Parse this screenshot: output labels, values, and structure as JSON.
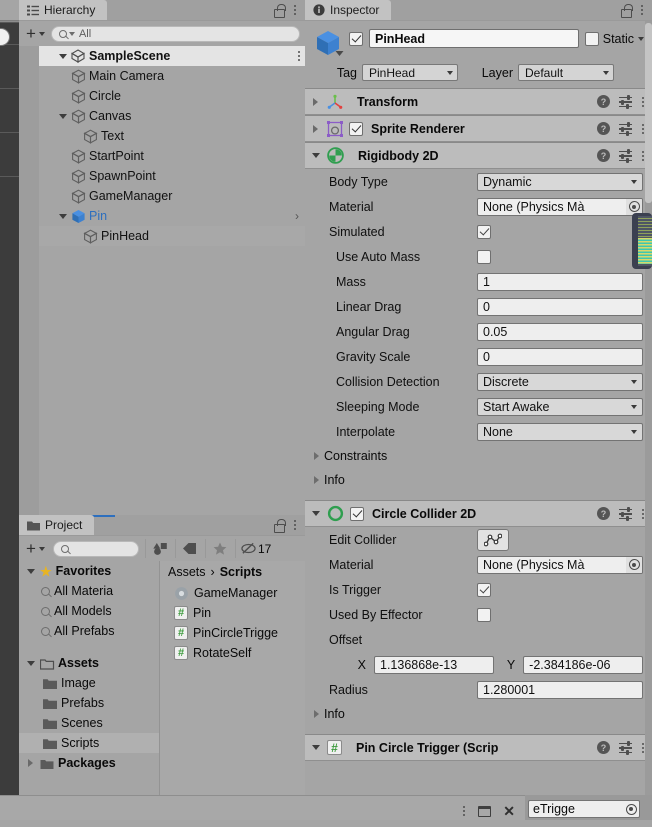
{
  "hierarchy": {
    "tab_label": "Hierarchy",
    "tab_icon": "hierarchy-icon",
    "lock_icon": "lock-icon",
    "menu_icon": "kebab-menu-icon",
    "add_label": "+",
    "search_placeholder": "All",
    "search_value": "",
    "scene": {
      "name": "SampleScene",
      "expanded": true
    },
    "items": [
      {
        "name": "Main Camera",
        "depth": 2,
        "expandable": false,
        "selected": false,
        "prefab": false
      },
      {
        "name": "Circle",
        "depth": 2,
        "expandable": false,
        "selected": false,
        "prefab": false
      },
      {
        "name": "Canvas",
        "depth": 2,
        "expandable": true,
        "selected": false,
        "prefab": false
      },
      {
        "name": "Text",
        "depth": 3,
        "expandable": false,
        "selected": false,
        "prefab": false
      },
      {
        "name": "StartPoint",
        "depth": 2,
        "expandable": false,
        "selected": false,
        "prefab": false
      },
      {
        "name": "SpawnPoint",
        "depth": 2,
        "expandable": false,
        "selected": false,
        "prefab": false
      },
      {
        "name": "GameManager",
        "depth": 2,
        "expandable": false,
        "selected": false,
        "prefab": false
      },
      {
        "name": "Pin",
        "depth": 2,
        "expandable": true,
        "selected": false,
        "prefab": true
      },
      {
        "name": "PinHead",
        "depth": 3,
        "expandable": false,
        "selected": true,
        "prefab": false
      }
    ]
  },
  "project": {
    "tab_label": "Project",
    "tab_icon": "folder-icon",
    "add_label": "+",
    "search_placeholder": "",
    "search_value": "",
    "toolbar_icons": [
      "packages-icon",
      "label-icon",
      "favorite-star-icon",
      "hidden-count-icon"
    ],
    "hidden_count": "17",
    "favorites": {
      "label": "Favorites",
      "items": [
        "All Materia",
        "All Models",
        "All Prefabs"
      ]
    },
    "assets": {
      "label": "Assets",
      "items": [
        "Image",
        "Prefabs",
        "Scenes",
        "Scripts"
      ],
      "selected": "Scripts"
    },
    "packages": {
      "label": "Packages"
    },
    "breadcrumb": {
      "root": "Assets",
      "separator": "›",
      "current": "Scripts"
    },
    "files": [
      {
        "name": "GameManager",
        "icon": "gear-script-icon"
      },
      {
        "name": "Pin",
        "icon": "csharp-script-icon"
      },
      {
        "name": "PinCircleTrigge",
        "icon": "csharp-script-icon"
      },
      {
        "name": "RotateSelf",
        "icon": "csharp-script-icon"
      }
    ]
  },
  "inspector": {
    "tab_label": "Inspector",
    "tab_icon": "info-icon",
    "lock_icon": "lock-icon",
    "menu_icon": "kebab-menu-icon",
    "object": {
      "icon": "prefab-cube-icon",
      "enabled": true,
      "name": "PinHead",
      "static_label": "Static",
      "static_checked": false,
      "tag_label": "Tag",
      "tag_value": "PinHead",
      "layer_label": "Layer",
      "layer_value": "Default"
    },
    "components": [
      {
        "id": "transform",
        "title": "Transform",
        "icon": "transform-axis-icon",
        "expanded": false,
        "has_toggle": false
      },
      {
        "id": "sprite-renderer",
        "title": "Sprite Renderer",
        "icon": "sprite-renderer-icon",
        "expanded": false,
        "has_toggle": true,
        "enabled": true
      },
      {
        "id": "rigidbody-2d",
        "title": "Rigidbody 2D",
        "icon": "rigidbody2d-icon",
        "expanded": true,
        "has_toggle": false,
        "properties": [
          {
            "label": "Body Type",
            "type": "dropdown",
            "value": "Dynamic"
          },
          {
            "label": "Material",
            "type": "object",
            "value": "None (Physics Mà"
          },
          {
            "label": "Simulated",
            "type": "checkbox",
            "value": true
          },
          {
            "label": "Use Auto Mass",
            "type": "checkbox",
            "value": false,
            "indent": true
          },
          {
            "label": "Mass",
            "type": "text",
            "value": "1",
            "indent": true
          },
          {
            "label": "Linear Drag",
            "type": "text",
            "value": "0",
            "indent": true
          },
          {
            "label": "Angular Drag",
            "type": "text",
            "value": "0.05",
            "indent": true
          },
          {
            "label": "Gravity Scale",
            "type": "text",
            "value": "0",
            "indent": true
          },
          {
            "label": "Collision Detection",
            "type": "dropdown",
            "value": "Discrete",
            "indent": true
          },
          {
            "label": "Sleeping Mode",
            "type": "dropdown",
            "value": "Start Awake",
            "indent": true
          },
          {
            "label": "Interpolate",
            "type": "dropdown",
            "value": "None",
            "indent": true
          }
        ],
        "foldouts": [
          "Constraints",
          "Info"
        ]
      },
      {
        "id": "circle-collider-2d",
        "title": "Circle Collider 2D",
        "icon": "circle-collider2d-icon",
        "expanded": true,
        "has_toggle": true,
        "enabled": true,
        "properties": [
          {
            "label": "Edit Collider",
            "type": "button",
            "value": "edit-collider-icon"
          },
          {
            "label": "Material",
            "type": "object",
            "value": "None (Physics Mà"
          },
          {
            "label": "Is Trigger",
            "type": "checkbox",
            "value": true
          },
          {
            "label": "Used By Effector",
            "type": "checkbox",
            "value": false
          },
          {
            "label": "Offset",
            "type": "header"
          },
          {
            "label": "Radius",
            "type": "text",
            "value": "1.280001"
          }
        ],
        "offset": {
          "x_label": "X",
          "x_value": "1.136868e-13",
          "y_label": "Y",
          "y_value": "-2.384186e-06"
        },
        "foldouts": [
          "Info"
        ]
      },
      {
        "id": "pin-circle-trigger-script",
        "title": "Pin Circle Trigger (Scrip",
        "icon": "csharp-script-icon",
        "expanded": true,
        "has_toggle": false
      }
    ]
  },
  "floating_bar": {
    "menu_icon": "kebab-menu-icon",
    "maximize_icon": "window-icon",
    "close_icon": "close-icon",
    "trailing_field_value": "eTrigge"
  },
  "colors": {
    "panel_bg": "#a5a5a5",
    "tab_active": "#c2c2c2",
    "tab_bar": "#a0a0a0",
    "component_header": "#bcbcbc",
    "field_bg": "#eeeeee",
    "dropdown_bg": "#d8d8d8",
    "selection": "#a8a8a8",
    "scene_row": "#e4e4e4",
    "prefab_blue": "#4a90e2",
    "star_gold": "#e8b422",
    "script_green": "#3f9c3f",
    "rigidbody_green": "#2f9e4f",
    "dark_strip": "#3c3c3c"
  }
}
